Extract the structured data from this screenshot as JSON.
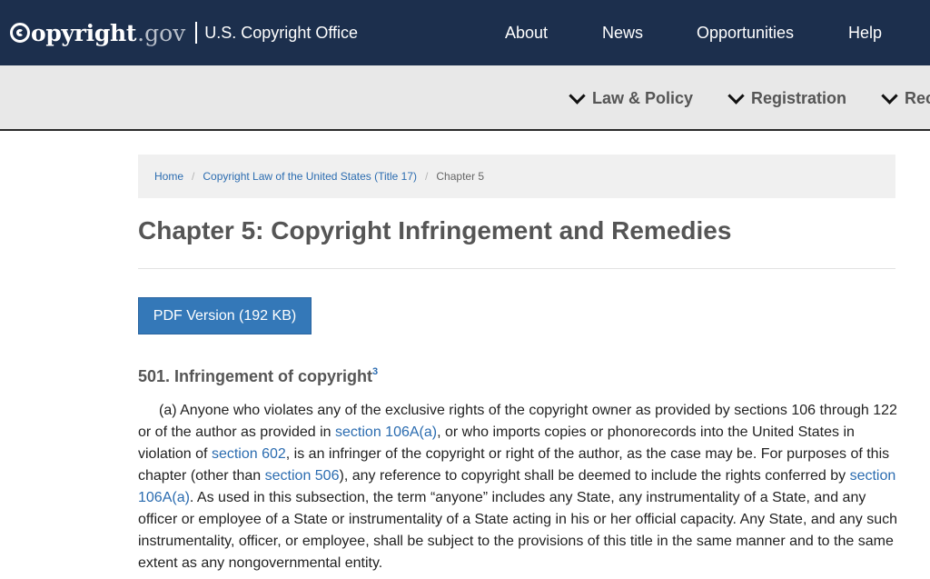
{
  "header": {
    "logo_text": "opyright",
    "logo_tld": ".gov",
    "office_name": "U.S. Copyright Office",
    "nav": {
      "about": "About",
      "news": "News",
      "opportunities": "Opportunities",
      "help": "Help"
    }
  },
  "subnav": {
    "law_policy": "Law & Policy",
    "registration": "Registration",
    "recordation": "Rec"
  },
  "breadcrumb": {
    "home": "Home",
    "title17": "Copyright Law of the United States (Title 17)",
    "current": "Chapter 5"
  },
  "page": {
    "title": "Chapter 5: Copyright Infringement and Remedies",
    "pdf_button": "PDF Version (192 KB)",
    "section_heading": "501. Infringement of copyright",
    "section_footnote": "3",
    "paragraph": {
      "t1": "(a) Anyone who violates any of the exclusive rights of the copyright owner as provided by sections 106 through 122 or of the author as provided in ",
      "l1": "section 106A(a)",
      "t2": ", or who imports copies or phonorecords into the United States in violation of ",
      "l2": "section 602",
      "t3": ", is an infringer of the copyright or right of the author, as the case may be. For purposes of this chapter (other than ",
      "l3": "section 506",
      "t4": "), any reference to copyright shall be deemed to include the rights conferred by ",
      "l4": "section 106A(a)",
      "t5": ". As used in this subsection, the term “anyone” includes any State, any instrumentality of a State, and any officer or employee of a State or instrumentality of a State acting in his or her official capacity. Any State, and any such instrumentality, officer, or employee, shall be subject to the provisions of this title in the same manner and to the same extent as any nongovernmental entity."
    }
  },
  "colors": {
    "header_bg": "#1c2f4d",
    "subnav_bg": "#e8e8e8",
    "link": "#2b6cb0",
    "button": "#3478b8"
  }
}
